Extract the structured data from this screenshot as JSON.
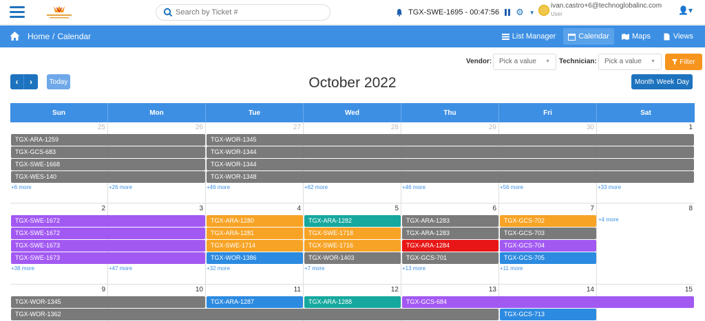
{
  "colors": {
    "gray": "#7a7a7a",
    "purple": "#a259f2",
    "orange": "#f7a325",
    "teal": "#16a89e",
    "red": "#e81616",
    "blue": "#2c8ae0",
    "nav": "#3d8fe3"
  },
  "header": {
    "search_placeholder": "Search by Ticket #",
    "ticket_timer": "TGX-SWE-1695 - 00:47:56",
    "user_email": "ivan.castro+6@technoglobalinc.com",
    "user_role": "User"
  },
  "breadcrumb": {
    "home": "Home",
    "current": "Calendar"
  },
  "nav_tabs": [
    "List Manager",
    "Calendar",
    "Maps",
    "Views"
  ],
  "filters": {
    "vendor_label": "Vendor:",
    "vendor_value": "Pick a value",
    "technician_label": "Technician:",
    "technician_value": "Pick a value",
    "filter_button": "Filter"
  },
  "toolbar": {
    "today": "Today",
    "title": "October 2022",
    "views": [
      "Month",
      "Week",
      "Day"
    ]
  },
  "calendar": {
    "days": [
      "Sun",
      "Mon",
      "Tue",
      "Wed",
      "Thu",
      "Fri",
      "Sat"
    ],
    "weeks": [
      {
        "dates": [
          {
            "d": "25",
            "other": true
          },
          {
            "d": "26",
            "other": true
          },
          {
            "d": "27",
            "other": true
          },
          {
            "d": "28",
            "other": true
          },
          {
            "d": "29",
            "other": true
          },
          {
            "d": "30",
            "other": true
          },
          {
            "d": "1",
            "other": false
          }
        ],
        "events": [
          {
            "label": "TGX-ARA-1259",
            "start": 0,
            "span": 2,
            "row": 0,
            "color": "gray"
          },
          {
            "label": "TGX-WOR-1345",
            "start": 2,
            "span": 5,
            "row": 0,
            "color": "gray"
          },
          {
            "label": "TGX-GCS-683",
            "start": 0,
            "span": 2,
            "row": 1,
            "color": "gray"
          },
          {
            "label": "TGX-WOR-1344",
            "start": 2,
            "span": 5,
            "row": 1,
            "color": "gray"
          },
          {
            "label": "TGX-SWE-1668",
            "start": 0,
            "span": 2,
            "row": 2,
            "color": "gray"
          },
          {
            "label": "TGX-WOR-1344",
            "start": 2,
            "span": 5,
            "row": 2,
            "color": "gray"
          },
          {
            "label": "TGX-WES-140",
            "start": 0,
            "span": 2,
            "row": 3,
            "color": "gray"
          },
          {
            "label": "TGX-WOR-1348",
            "start": 2,
            "span": 5,
            "row": 3,
            "color": "gray"
          }
        ],
        "more": [
          "+6 more",
          "+26 more",
          "+46 more",
          "+62 more",
          "+46 more",
          "+56 more",
          "+33 more"
        ]
      },
      {
        "dates": [
          {
            "d": "2",
            "other": false
          },
          {
            "d": "3",
            "other": false
          },
          {
            "d": "4",
            "other": false
          },
          {
            "d": "5",
            "other": false
          },
          {
            "d": "6",
            "other": false
          },
          {
            "d": "7",
            "other": false
          },
          {
            "d": "8",
            "other": false
          }
        ],
        "events": [
          {
            "label": "TGX-SWE-1672",
            "start": 0,
            "span": 2,
            "row": 0,
            "color": "purple"
          },
          {
            "label": "TGX-ARA-1280",
            "start": 2,
            "span": 1,
            "row": 0,
            "color": "orange"
          },
          {
            "label": "TGX-ARA-1282",
            "start": 3,
            "span": 1,
            "row": 0,
            "color": "teal"
          },
          {
            "label": "TGX-ARA-1283",
            "start": 4,
            "span": 1,
            "row": 0,
            "color": "gray"
          },
          {
            "label": "TGX-GCS-702",
            "start": 5,
            "span": 1,
            "row": 0,
            "color": "orange"
          },
          {
            "label": "TGX-SWE-1672",
            "start": 0,
            "span": 2,
            "row": 1,
            "color": "purple"
          },
          {
            "label": "TGX-ARA-1281",
            "start": 2,
            "span": 1,
            "row": 1,
            "color": "orange"
          },
          {
            "label": "TGX-SWE-1718",
            "start": 3,
            "span": 1,
            "row": 1,
            "color": "orange"
          },
          {
            "label": "TGX-ARA-1283",
            "start": 4,
            "span": 1,
            "row": 1,
            "color": "gray"
          },
          {
            "label": "TGX-GCS-703",
            "start": 5,
            "span": 1,
            "row": 1,
            "color": "gray"
          },
          {
            "label": "TGX-SWE-1673",
            "start": 0,
            "span": 2,
            "row": 2,
            "color": "purple"
          },
          {
            "label": "TGX-SWE-1714",
            "start": 2,
            "span": 1,
            "row": 2,
            "color": "orange"
          },
          {
            "label": "TGX-SWE-1716",
            "start": 3,
            "span": 1,
            "row": 2,
            "color": "orange"
          },
          {
            "label": "TGX-ARA-1284",
            "start": 4,
            "span": 1,
            "row": 2,
            "color": "red"
          },
          {
            "label": "TGX-GCS-704",
            "start": 5,
            "span": 1,
            "row": 2,
            "color": "purple"
          },
          {
            "label": "TGX-SWE-1673",
            "start": 0,
            "span": 2,
            "row": 3,
            "color": "purple"
          },
          {
            "label": "TGX-WOR-1386",
            "start": 2,
            "span": 1,
            "row": 3,
            "color": "blue"
          },
          {
            "label": "TGX-WOR-1403",
            "start": 3,
            "span": 1,
            "row": 3,
            "color": "gray"
          },
          {
            "label": "TGX-GCS-701",
            "start": 4,
            "span": 1,
            "row": 3,
            "color": "gray"
          },
          {
            "label": "TGX-GCS-705",
            "start": 5,
            "span": 1,
            "row": 3,
            "color": "blue"
          }
        ],
        "more": [
          "+38 more",
          "+47 more",
          "+32 more",
          "+7 more",
          "+13 more",
          "+11 more",
          ""
        ],
        "top_more": [
          {
            "col": 6,
            "label": "+4 more"
          }
        ]
      },
      {
        "dates": [
          {
            "d": "9",
            "other": false
          },
          {
            "d": "10",
            "other": false
          },
          {
            "d": "11",
            "other": false
          },
          {
            "d": "12",
            "other": false
          },
          {
            "d": "13",
            "other": false
          },
          {
            "d": "14",
            "other": false
          },
          {
            "d": "15",
            "other": false
          }
        ],
        "events": [
          {
            "label": "TGX-WOR-1345",
            "start": 0,
            "span": 2,
            "row": 0,
            "color": "gray"
          },
          {
            "label": "TGX-ARA-1287",
            "start": 2,
            "span": 1,
            "row": 0,
            "color": "blue"
          },
          {
            "label": "TGX-ARA-1288",
            "start": 3,
            "span": 1,
            "row": 0,
            "color": "teal"
          },
          {
            "label": "TGX-GCS-684",
            "start": 4,
            "span": 3,
            "row": 0,
            "color": "purple"
          },
          {
            "label": "TGX-WOR-1362",
            "start": 0,
            "span": 5,
            "row": 1,
            "color": "gray"
          },
          {
            "label": "TGX-GCS-713",
            "start": 5,
            "span": 1,
            "row": 1,
            "color": "blue"
          }
        ],
        "more": [
          "",
          "",
          "",
          "",
          "",
          "",
          ""
        ]
      }
    ]
  }
}
